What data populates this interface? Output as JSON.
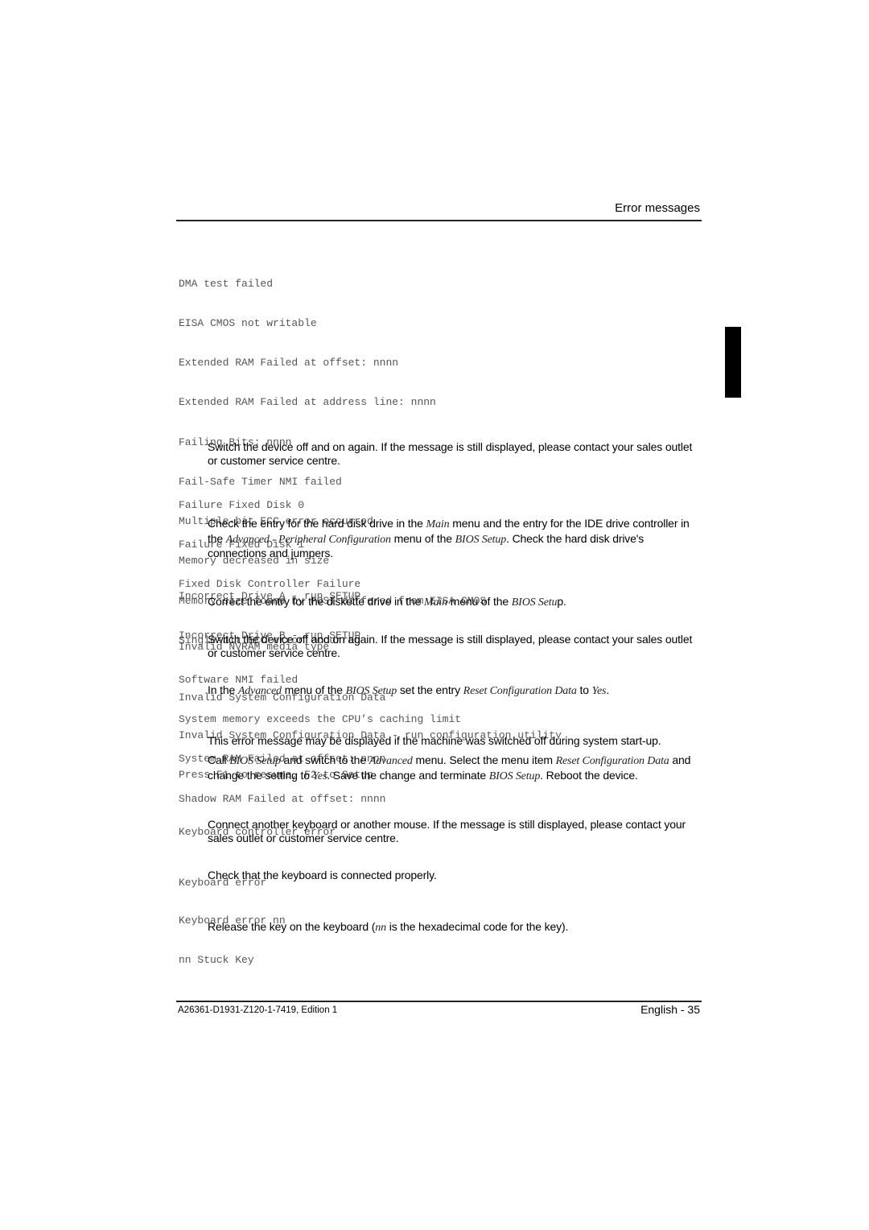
{
  "header": {
    "title": "Error messages"
  },
  "sections": [
    {
      "codes": [
        "DMA test failed",
        "EISA CMOS not writable",
        "Extended RAM Failed at offset: nnnn",
        "Extended RAM Failed at address line: nnnn",
        "Failing Bits: nnnn",
        "Fail-Safe Timer NMI failed",
        "Multiple-bit ECC error occurred",
        "Memory decreased in size",
        "Memory size found by POST differed from EISA CMOS",
        "Single-bit ECC error occurred",
        "Software NMI failed",
        "System memory exceeds the CPU’s caching limit",
        "System RAM Failed at offset: nnnn",
        "Shadow RAM Failed at offset: nnnn"
      ],
      "text": "Switch the device off and on again. If the message is still displayed, please contact your sales outlet or customer service centre."
    },
    {
      "codes": [
        "Failure Fixed Disk 0",
        "Failure Fixed Disk 1",
        "Fixed Disk Controller Failure"
      ],
      "text_parts": [
        "Check the entry for the hard disk drive in the ",
        "Main",
        " menu and the entry for the IDE drive controller in the ",
        "Advanced - Peripheral Configuration",
        " menu of the ",
        "BIOS Setup",
        ". Check the hard disk drive's connections and jumpers."
      ]
    },
    {
      "codes": [
        "Incorrect Drive A - run SETUP",
        "Incorrect Drive B - run SETUP"
      ],
      "text_parts": [
        "Correct the entry for the diskette drive in the ",
        "Main",
        " menu of the ",
        "BIOS Setu",
        "p."
      ]
    },
    {
      "codes": [
        "Invalid NVRAM media type"
      ],
      "text": "Switch the device off and on again. If the message is still displayed, please contact your sales outlet or customer service centre."
    },
    {
      "codes": [
        "Invalid System Configuration Data"
      ],
      "text_parts": [
        "In the ",
        "Advanced",
        " menu of the ",
        "BIOS Setup",
        " set the entry ",
        "Reset Configuration Data",
        " to ",
        "Yes",
        "."
      ]
    },
    {
      "codes": [
        "Invalid System Configuration Data - run configuration utility",
        "Press F1 to resume, F2 to Setup"
      ],
      "text": "This error message may be displayed if the machine was switched off during system start-up.",
      "text2_parts": [
        "Call ",
        "BIOS Setup",
        " and switch to the ",
        "Advanced",
        " menu. Select the menu item ",
        "Reset Configuration Data",
        " and change the setting to ",
        "Yes",
        ". Save the change and terminate ",
        "BIOS Setup",
        ". Reboot the device."
      ]
    },
    {
      "codes": [
        "Keyboard controller error"
      ],
      "text": "Connect another keyboard or another mouse. If the message is still displayed, please contact your sales outlet or customer service centre."
    },
    {
      "codes": [
        "Keyboard error"
      ],
      "text": "Check that the keyboard is connected properly."
    },
    {
      "codes": [
        "Keyboard error nn",
        "nn Stuck Key"
      ],
      "text_parts": [
        "Release the key on the keyboard (",
        "nn",
        " is the hexadecimal code for the key)."
      ]
    }
  ],
  "footer": {
    "doc_id": "A26361-D1931-Z120-1-7419, Edition 1",
    "page_label": "English - 35"
  }
}
